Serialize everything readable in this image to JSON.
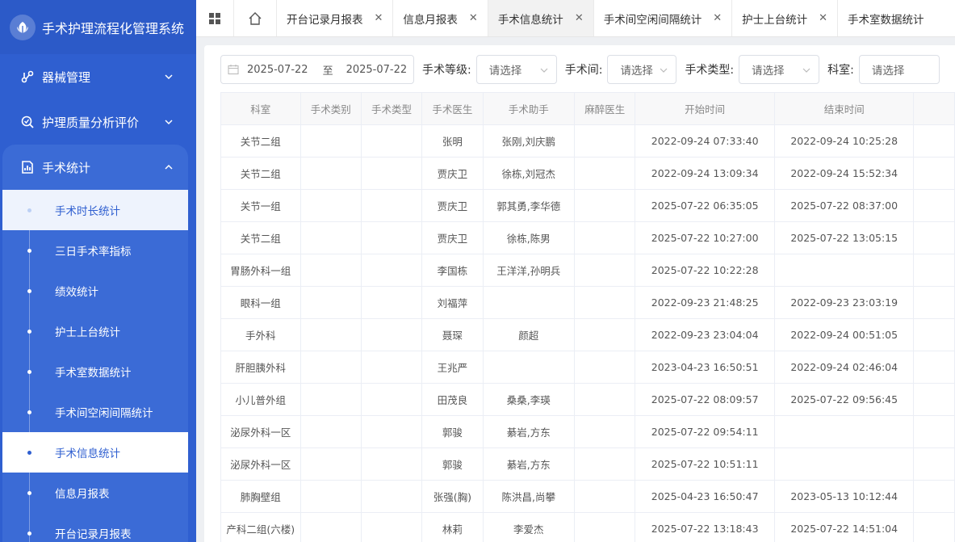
{
  "app": {
    "title": "手术护理流程化管理系统"
  },
  "sidebar": {
    "groups": [
      {
        "label": "器械管理",
        "icon": "instrument-icon"
      },
      {
        "label": "护理质量分析评价",
        "icon": "quality-analysis-icon"
      },
      {
        "label": "手术统计",
        "icon": "statistics-icon"
      }
    ],
    "sub_items": [
      {
        "label": "手术时长统计"
      },
      {
        "label": "三日手术率指标"
      },
      {
        "label": "绩效统计"
      },
      {
        "label": "护士上台统计"
      },
      {
        "label": "手术室数据统计"
      },
      {
        "label": "手术间空闲间隔统计"
      },
      {
        "label": "手术信息统计"
      },
      {
        "label": "信息月报表"
      },
      {
        "label": "开台记录月报表"
      }
    ]
  },
  "tabs": [
    {
      "label": "开台记录月报表"
    },
    {
      "label": "信息月报表"
    },
    {
      "label": "手术信息统计"
    },
    {
      "label": "手术间空闲间隔统计"
    },
    {
      "label": "护士上台统计"
    },
    {
      "label": "手术室数据统计"
    }
  ],
  "filters": {
    "date_start": "2025-07-22",
    "date_sep": "至",
    "date_end": "2025-07-22",
    "level_label": "手术等级:",
    "room_label": "手术间:",
    "type_label": "手术类型:",
    "dept_label": "科室:",
    "placeholder": "请选择"
  },
  "table": {
    "headers": [
      "科室",
      "手术类别",
      "手术类型",
      "手术医生",
      "手术助手",
      "麻醉医生",
      "开始时间",
      "结束时间",
      ""
    ],
    "rows": [
      [
        "关节二组",
        "",
        "",
        "张明",
        "张刚,刘庆鹏",
        "",
        "2022-09-24 07:33:40",
        "2022-09-24 10:25:28",
        ""
      ],
      [
        "关节二组",
        "",
        "",
        "贾庆卫",
        "徐栋,刘冠杰",
        "",
        "2022-09-24 13:09:34",
        "2022-09-24 15:52:34",
        ""
      ],
      [
        "关节一组",
        "",
        "",
        "贾庆卫",
        "郭其勇,李华德",
        "",
        "2025-07-22 06:35:05",
        "2025-07-22 08:37:00",
        ""
      ],
      [
        "关节二组",
        "",
        "",
        "贾庆卫",
        "徐栋,陈男",
        "",
        "2025-07-22 10:27:00",
        "2025-07-22 13:05:15",
        ""
      ],
      [
        "胃肠外科一组",
        "",
        "",
        "李国栋",
        "王洋洋,孙明兵",
        "",
        "2025-07-22 10:22:28",
        "",
        ""
      ],
      [
        "眼科一组",
        "",
        "",
        "刘福萍",
        "",
        "",
        "2022-09-23 21:48:25",
        "2022-09-23 23:03:19",
        ""
      ],
      [
        "手外科",
        "",
        "",
        "聂琛",
        "颜超",
        "",
        "2022-09-23 23:04:04",
        "2022-09-24 00:51:05",
        ""
      ],
      [
        "肝胆胰外科",
        "",
        "",
        "王兆严",
        "",
        "",
        "2023-04-23 16:50:51",
        "2022-09-24 02:46:04",
        ""
      ],
      [
        "小儿普外组",
        "",
        "",
        "田茂良",
        "桑桑,李瑛",
        "",
        "2025-07-22 08:09:57",
        "2025-07-22 09:56:45",
        ""
      ],
      [
        "泌尿外科一区",
        "",
        "",
        "郭骏",
        "綦岩,方东",
        "",
        "2025-07-22 09:54:11",
        "",
        ""
      ],
      [
        "泌尿外科一区",
        "",
        "",
        "郭骏",
        "綦岩,方东",
        "",
        "2025-07-22 10:51:11",
        "",
        ""
      ],
      [
        "肺胸壁组",
        "",
        "",
        "张强(胸)",
        "陈洪昌,尚攀",
        "",
        "2025-04-23 16:50:47",
        "2023-05-13 10:12:44",
        ""
      ],
      [
        "产科二组(六楼)",
        "",
        "",
        "林莉",
        "李爱杰",
        "",
        "2025-07-22 13:18:43",
        "2025-07-22 14:51:04",
        ""
      ]
    ]
  }
}
